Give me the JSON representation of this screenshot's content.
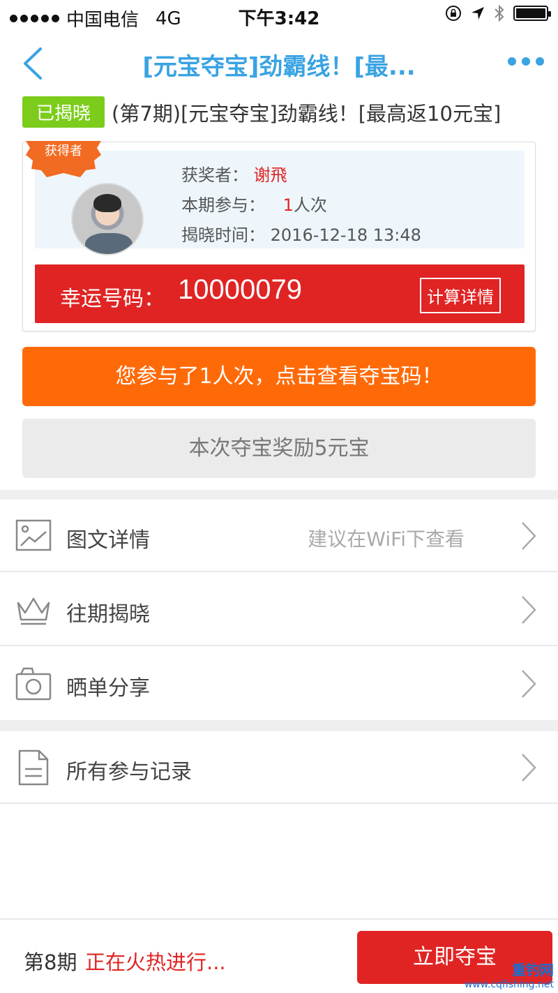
{
  "status_bar": {
    "carrier": "中国电信",
    "network": "4G",
    "time": "下午3:42"
  },
  "nav": {
    "title": "[元宝夺宝]劲霸线！[最...",
    "accent_color": "#3aa3e3"
  },
  "product": {
    "status_tag": "已揭晓",
    "title": "(第7期)[元宝夺宝]劲霸线！[最高返10元宝]"
  },
  "winner": {
    "ribbon_label": "获得者",
    "winner_label": "获奖者：",
    "winner_name": "谢飛",
    "participation_label": "本期参与：",
    "participation_count": "1",
    "participation_unit": "人次",
    "reveal_time_label": "揭晓时间：",
    "reveal_time": "2016-12-18 13:48",
    "lucky_label": "幸运号码：",
    "lucky_number": "10000079",
    "calc_button": "计算详情"
  },
  "actions": {
    "participated_button": "您参与了1人次，点击查看夺宝码！",
    "reward_button": "本次夺宝奖励5元宝"
  },
  "menu": {
    "details": {
      "label": "图文详情",
      "hint": "建议在WiFi下查看",
      "icon": "image-icon"
    },
    "history": {
      "label": "往期揭晓",
      "icon": "crown-icon"
    },
    "share": {
      "label": "晒单分享",
      "icon": "camera-icon"
    },
    "records": {
      "label": "所有参与记录",
      "icon": "document-icon"
    }
  },
  "bottom": {
    "period": "第8期",
    "period_status": "正在火热进行...",
    "buy_button": "立即夺宝"
  },
  "watermark": {
    "text": "重钓网",
    "url": "www.cqfishing.net"
  }
}
